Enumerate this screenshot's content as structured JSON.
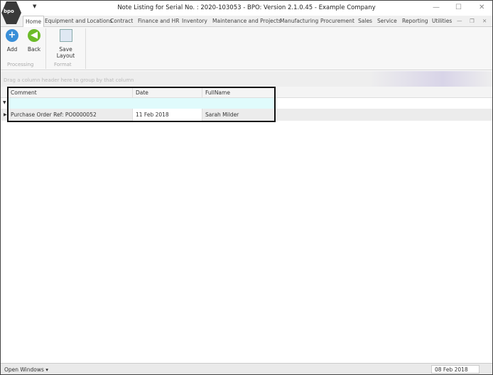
{
  "window": {
    "title": "Note Listing for Serial No. : 2020-103053 - BPO: Version 2.1.0.45 - Example Company",
    "logo_text": "bpo"
  },
  "tabs": [
    "Home",
    "Equipment and Locations",
    "Contract",
    "Finance and HR",
    "Inventory",
    "Maintenance and Projects",
    "Manufacturing",
    "Procurement",
    "Sales",
    "Service",
    "Reporting",
    "Utilities"
  ],
  "ribbon": {
    "add": "Add",
    "back": "Back",
    "save_layout": "Save Layout",
    "group_processing": "Processing",
    "group_format": "Format"
  },
  "grid": {
    "group_hint": "Drag a column header here to group by that column",
    "columns": [
      "Comment",
      "Date",
      "FullName"
    ],
    "rows": [
      [
        "Purchase Order Ref: PO0000052",
        "11 Feb 2018",
        "Sarah Milder"
      ]
    ]
  },
  "status": {
    "open_windows": "Open Windows",
    "date": "08 Feb 2018"
  },
  "colors": {
    "filter_row": "#e0fbfc",
    "add_icon": "#3a8fd8",
    "back_icon": "#6cbb2a"
  }
}
